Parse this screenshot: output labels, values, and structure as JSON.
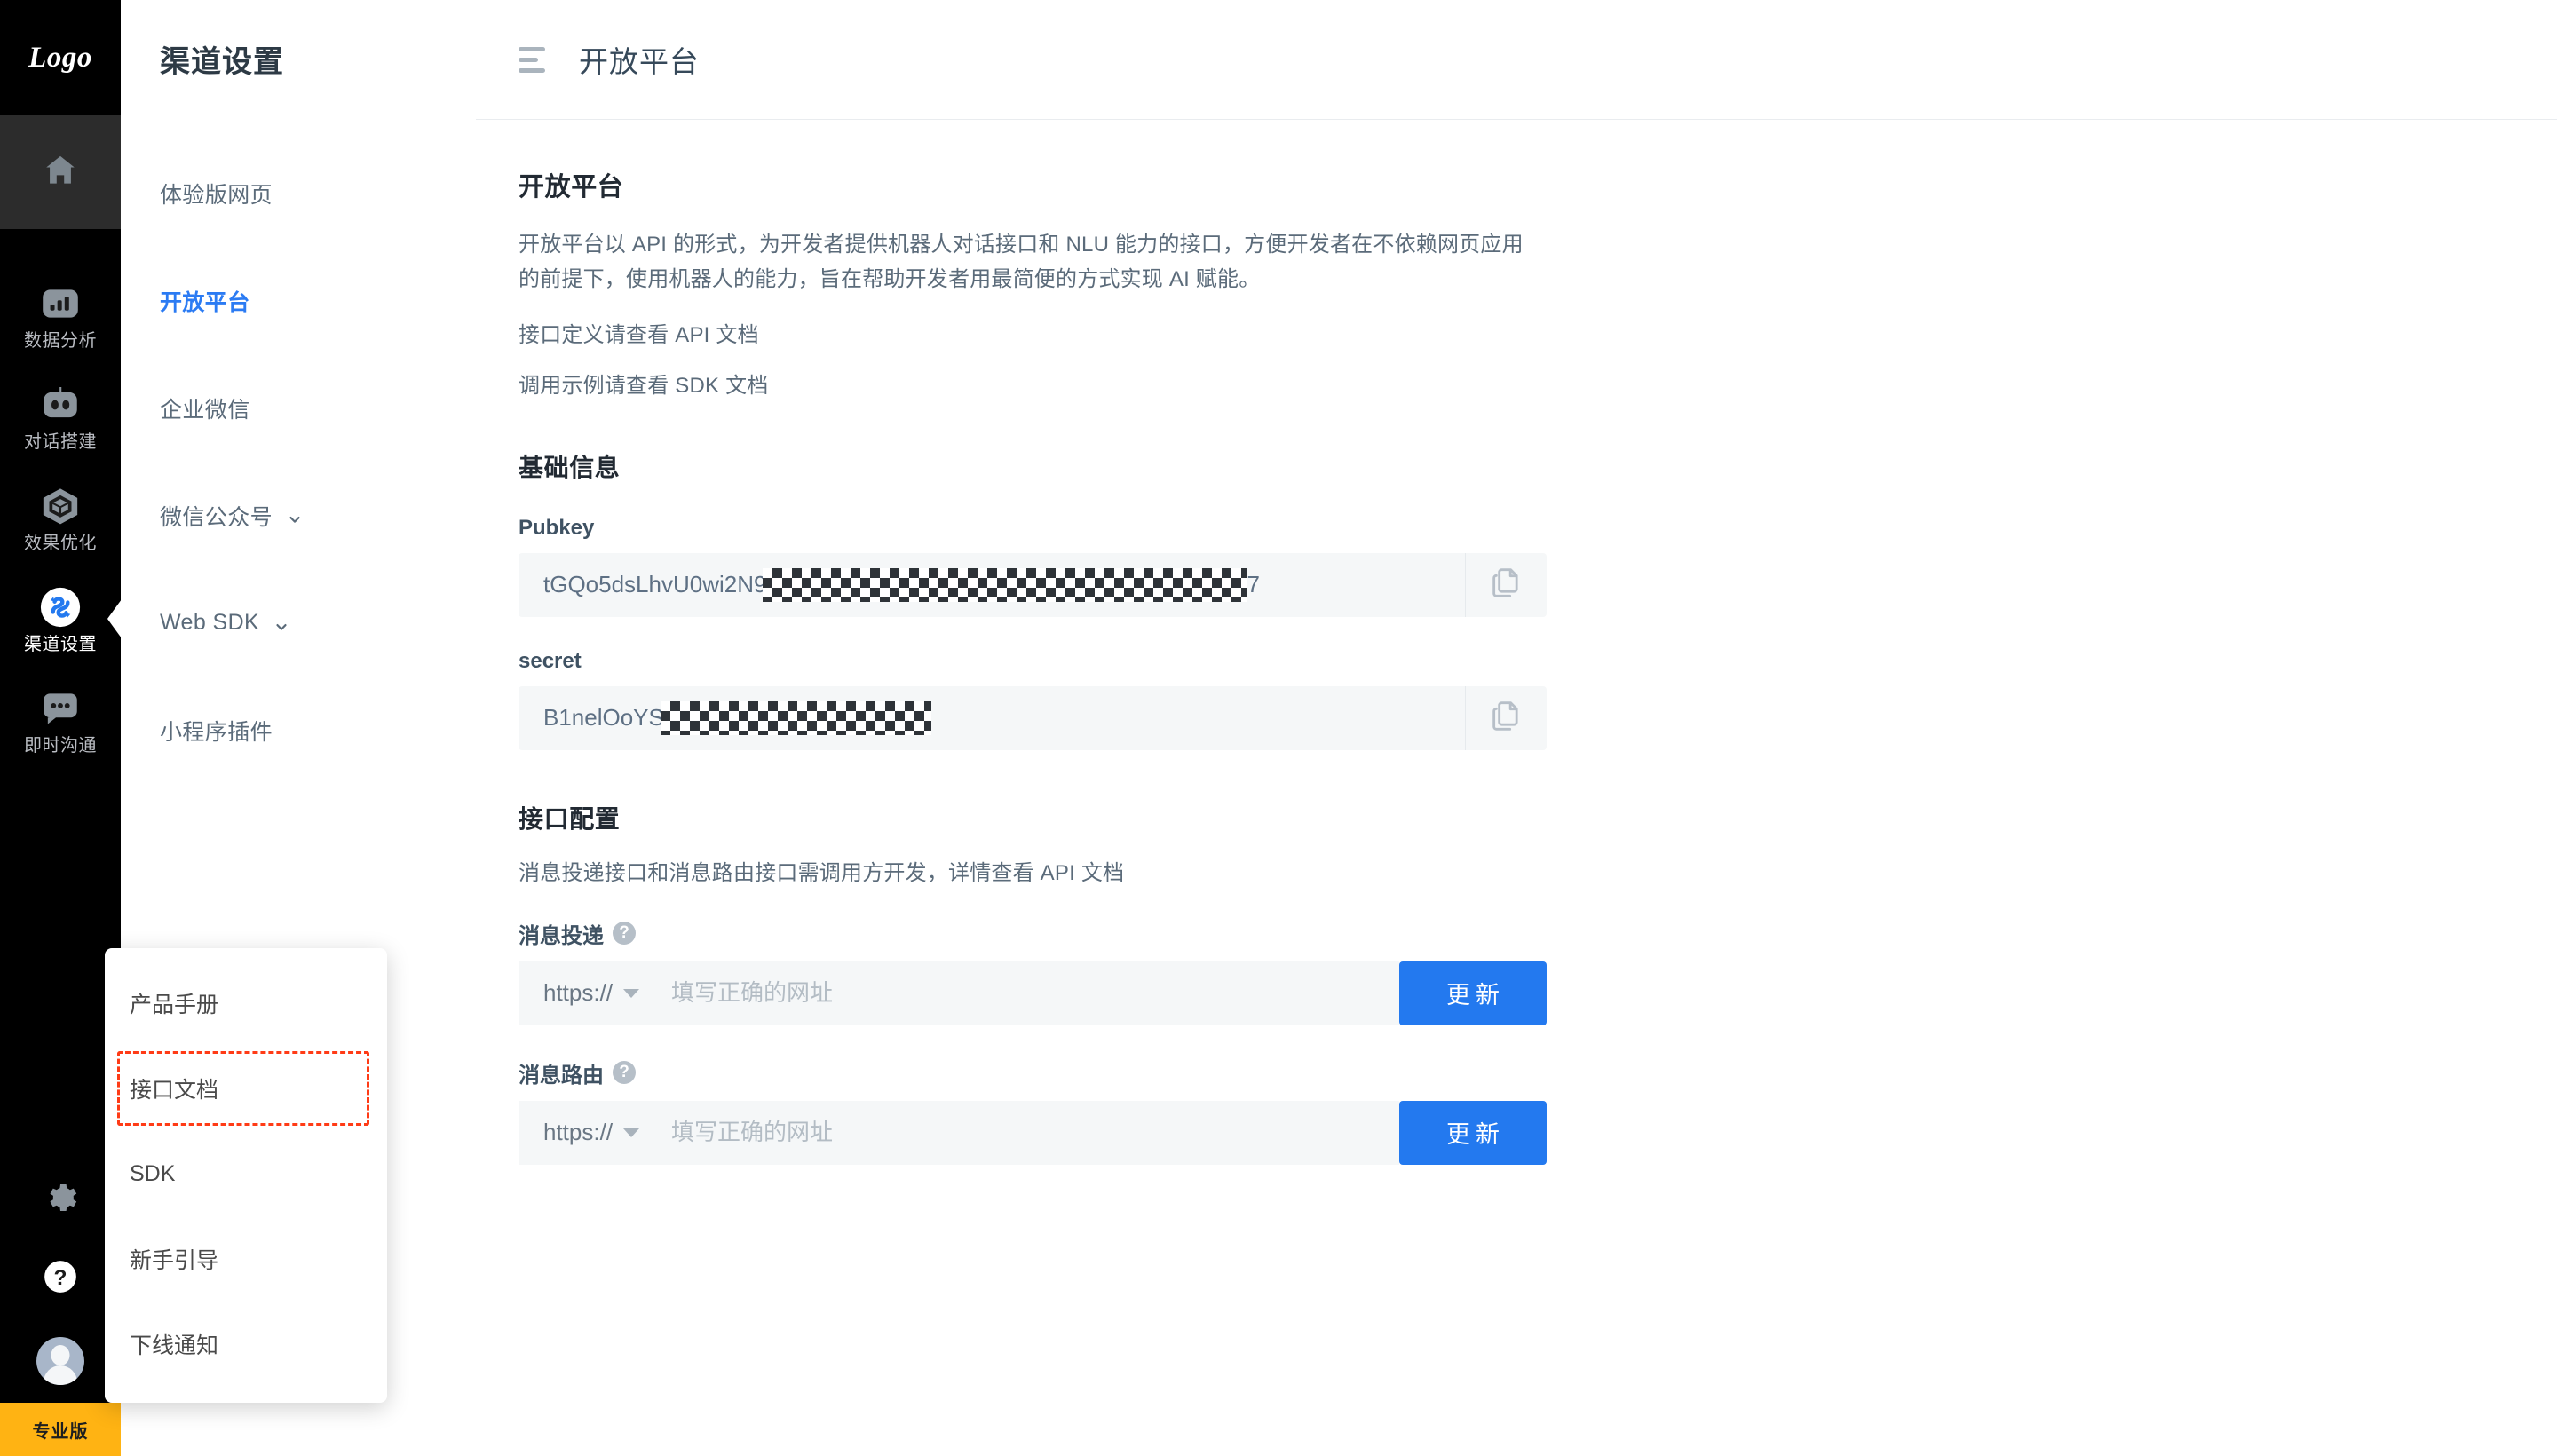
{
  "rail": {
    "logo": "Logo",
    "home_icon": "home-icon",
    "items": [
      {
        "label": "数据分析",
        "icon": "bar-chart-icon",
        "active": false
      },
      {
        "label": "对话搭建",
        "icon": "robot-icon",
        "active": false
      },
      {
        "label": "效果优化",
        "icon": "cube-icon",
        "active": false
      },
      {
        "label": "渠道设置",
        "icon": "channel-settings-icon",
        "active": true
      },
      {
        "label": "即时沟通",
        "icon": "chat-bubble-icon",
        "active": false
      }
    ],
    "bottom": {
      "settings_icon": "gear-icon",
      "help_icon": "question-circle-icon",
      "avatar": "user-avatar"
    },
    "pro_badge": "专业版"
  },
  "popup": {
    "items": [
      {
        "label": "产品手册",
        "highlighted": false
      },
      {
        "label": "接口文档",
        "highlighted": true
      },
      {
        "label": "SDK",
        "highlighted": false
      },
      {
        "label": "新手引导",
        "highlighted": false
      },
      {
        "label": "下线通知",
        "highlighted": false
      }
    ],
    "highlight_color": "#ff3b16"
  },
  "subnav": {
    "title": "渠道设置",
    "items": [
      {
        "label": "体验版网页",
        "active": false,
        "expandable": false
      },
      {
        "label": "开放平台",
        "active": true,
        "expandable": false
      },
      {
        "label": "企业微信",
        "active": false,
        "expandable": false
      },
      {
        "label": "微信公众号",
        "active": false,
        "expandable": true
      },
      {
        "label": "Web SDK",
        "active": false,
        "expandable": true
      },
      {
        "label": "小程序插件",
        "active": false,
        "expandable": false
      }
    ],
    "active_color": "#2b7bf3"
  },
  "topbar": {
    "menu_icon": "hamburger-icon",
    "title": "开放平台"
  },
  "content": {
    "page_heading": "开放平台",
    "description": "开放平台以 API 的形式，为开发者提供机器人对话接口和 NLU 能力的接口，方便开发者在不依赖网页应用的前提下，使用机器人的能力，旨在帮助开发者用最简便的方式实现 AI 赋能。",
    "link_line_1": "接口定义请查看 API 文档",
    "link_line_2": "调用示例请查看 SDK 文档",
    "basic_info": {
      "heading": "基础信息",
      "pubkey_label": "Pubkey",
      "pubkey_value": "tGQo5dsLhvU0wi2N9",
      "pubkey_suffix": "7",
      "secret_label": "secret",
      "secret_value": "B1nelOoYS",
      "copy_icon": "copy-icon"
    },
    "api_config": {
      "heading": "接口配置",
      "description": "消息投递接口和消息路由接口需调用方开发，详情查看 API 文档",
      "delivery": {
        "label": "消息投递",
        "help_icon": "help-icon",
        "protocol": "https://",
        "placeholder": "填写正确的网址",
        "value": "",
        "button": "更新"
      },
      "routing": {
        "label": "消息路由",
        "help_icon": "help-icon",
        "protocol": "https://",
        "placeholder": "填写正确的网址",
        "value": "",
        "button": "更新"
      }
    }
  },
  "colors": {
    "accent_blue": "#2379ef",
    "pro_yellow": "#ffb313",
    "rail_bg": "#000000"
  }
}
